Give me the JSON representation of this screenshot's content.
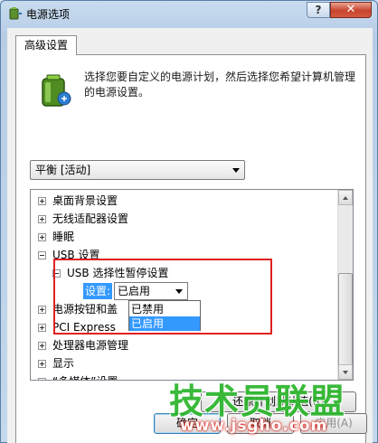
{
  "window": {
    "title": "电源选项",
    "help_label": "?",
    "close_label": "✕"
  },
  "tab": {
    "label": "高级设置"
  },
  "intro_text": "选择您要自定义的电源计划，然后选择您希望计算机管理的电源设置。",
  "plan_select": {
    "value": "平衡 [活动]"
  },
  "tree": {
    "items": [
      {
        "label": "桌面背景设置",
        "expanded": false
      },
      {
        "label": "无线适配器设置",
        "expanded": false
      },
      {
        "label": "睡眠",
        "expanded": false
      },
      {
        "label": "USB 设置",
        "expanded": true
      },
      {
        "label": "USB 选择性暂停设置",
        "expanded": true
      },
      {
        "label": "电源按钮和盖",
        "expanded": false
      },
      {
        "label": "PCI Express",
        "expanded": false
      },
      {
        "label": "处理器电源管理",
        "expanded": false
      },
      {
        "label": "显示",
        "expanded": false
      },
      {
        "label": "“多媒体”设置",
        "expanded": false
      }
    ],
    "setting_label": "设置:",
    "setting_value": "已启用",
    "dropdown_options": [
      "已禁用",
      "已启用"
    ],
    "dropdown_selected": "已启用"
  },
  "buttons": {
    "restore": "还原计划默认值(R)",
    "ok": "确定",
    "cancel": "取消",
    "apply": "应用(A)"
  },
  "watermark": {
    "title": "技术员联盟",
    "url": "www.jsgho.com"
  },
  "colors": {
    "highlight_box": "#e02020",
    "selection": "#3399ff",
    "watermark_green": "#2ab52a"
  }
}
